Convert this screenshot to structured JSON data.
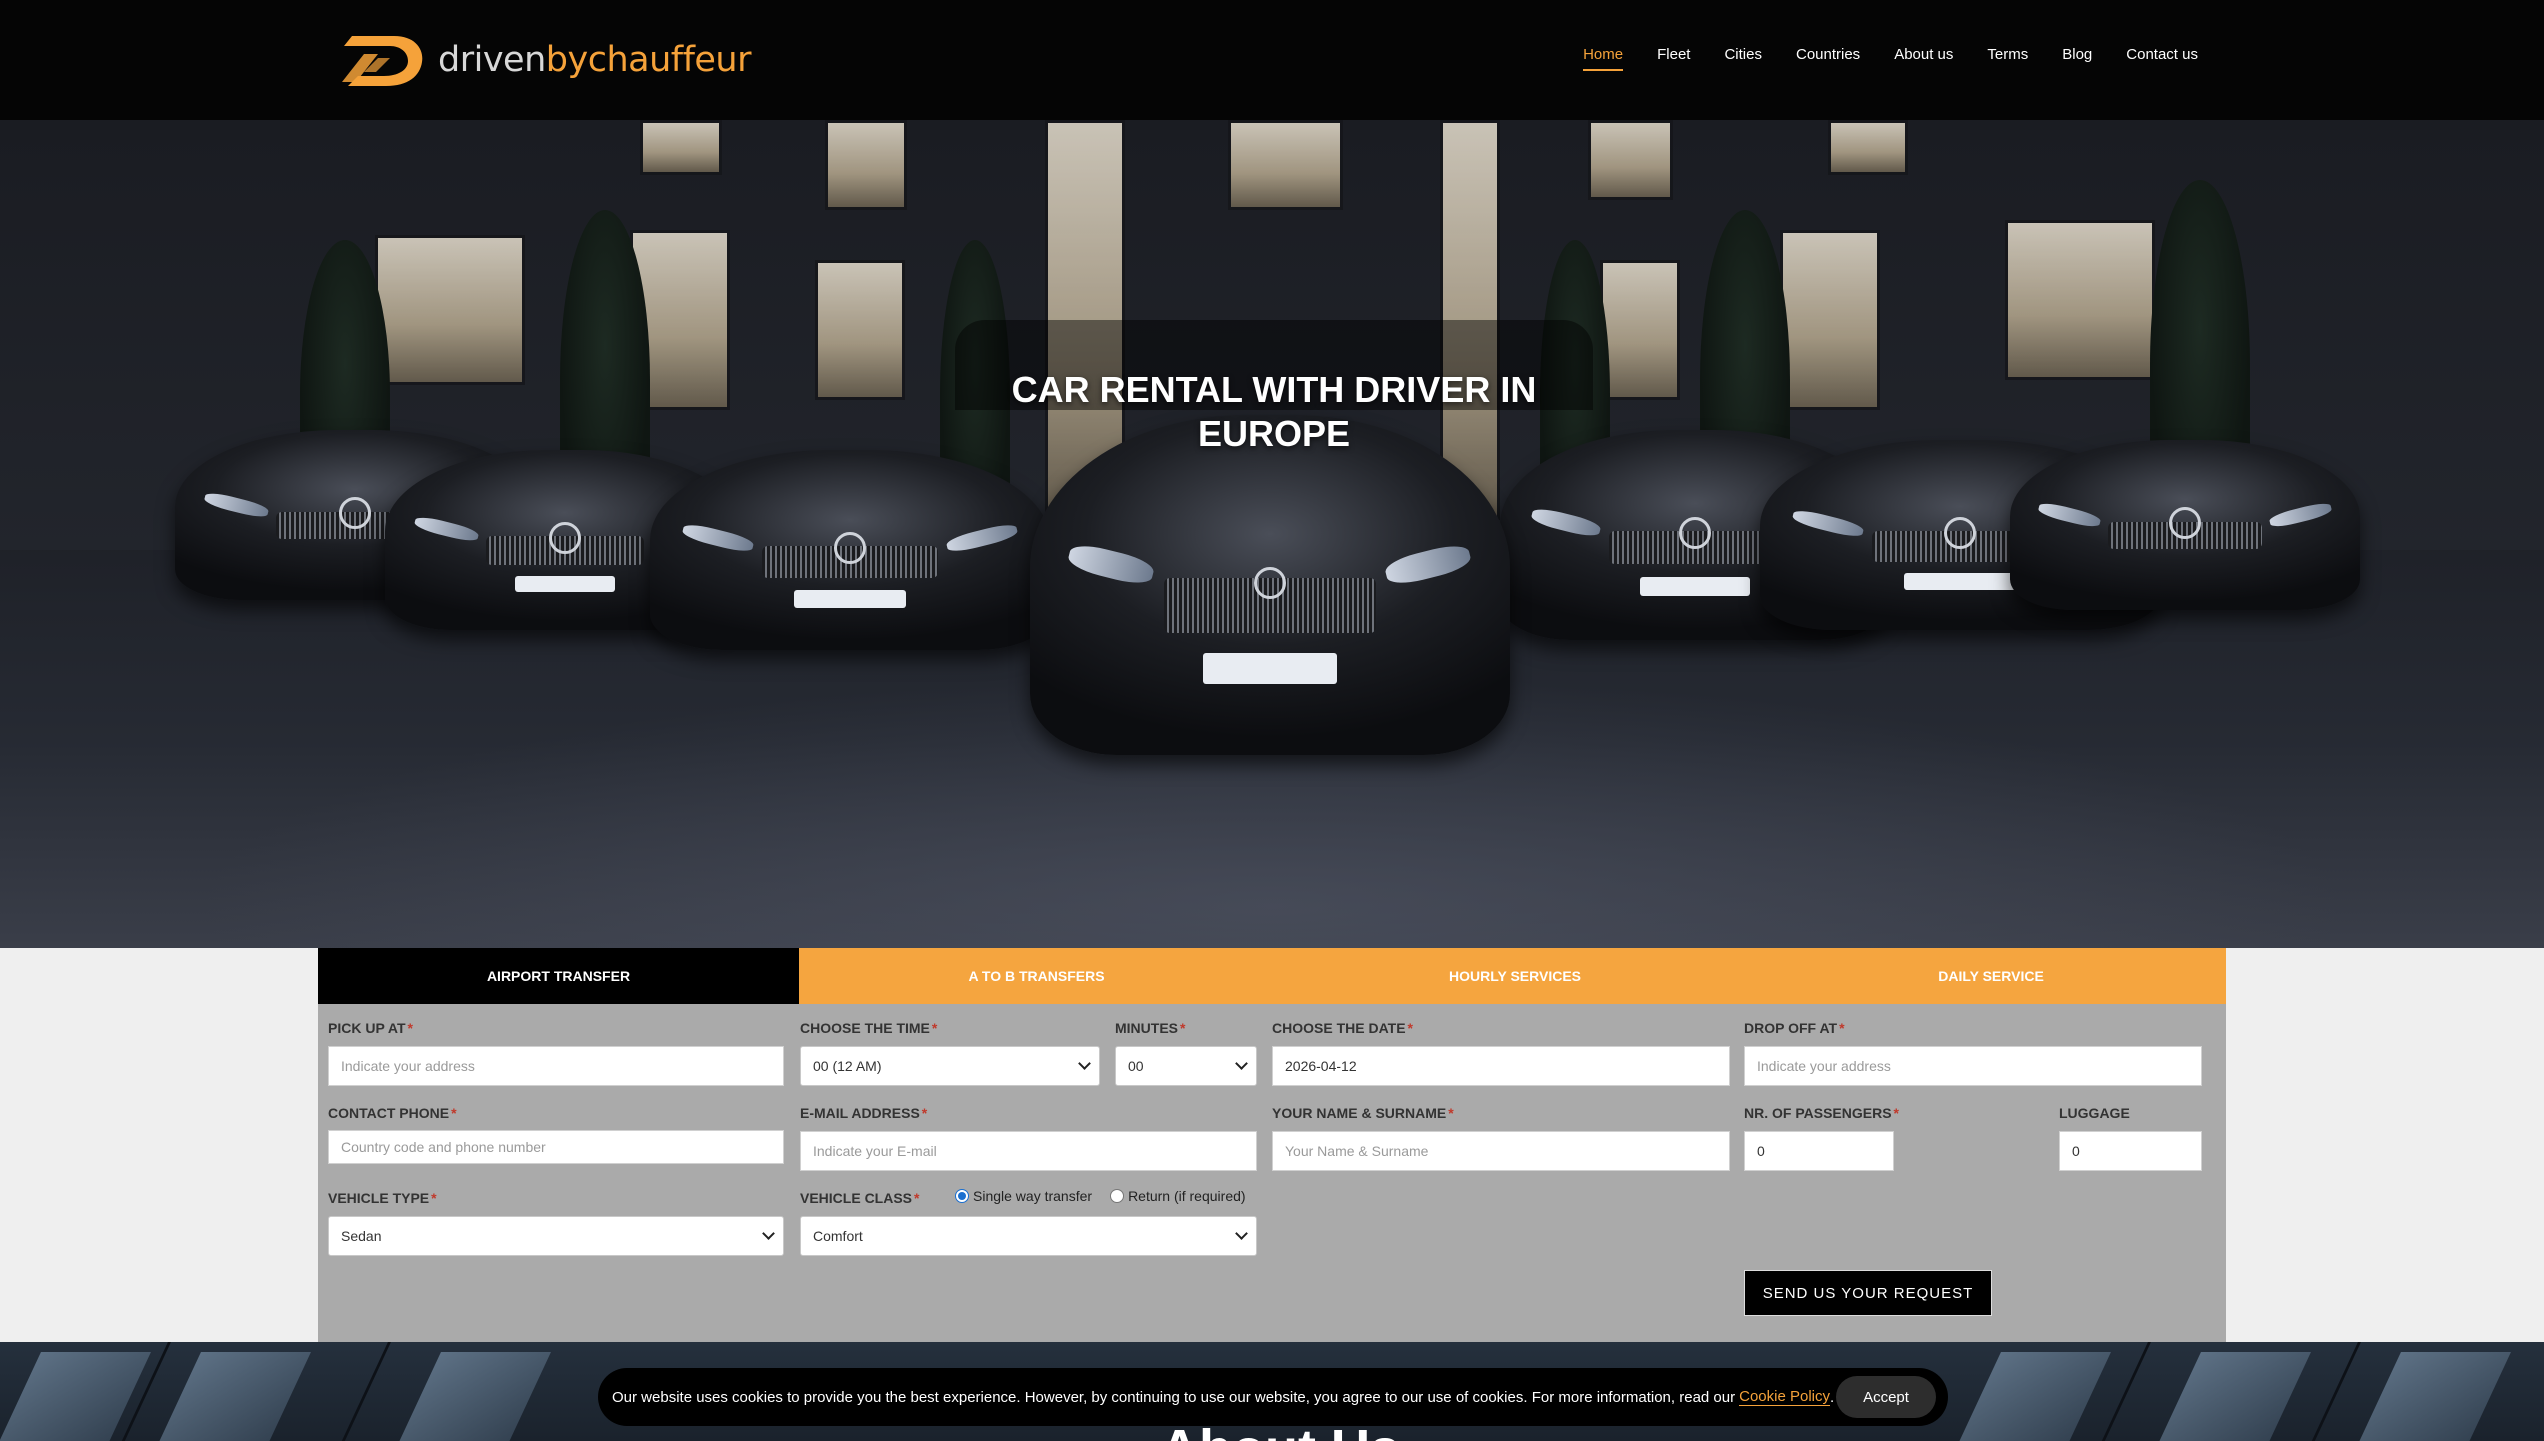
{
  "brand": {
    "logo_part1": "driven",
    "logo_part2": "bychauffeur",
    "accent_color": "#f5a23a"
  },
  "nav": {
    "items": [
      {
        "label": "Home",
        "active": true
      },
      {
        "label": "Fleet"
      },
      {
        "label": "Cities"
      },
      {
        "label": "Countries"
      },
      {
        "label": "About us"
      },
      {
        "label": "Terms"
      },
      {
        "label": "Blog"
      },
      {
        "label": "Contact us"
      }
    ]
  },
  "hero": {
    "title": "CAR RENTAL WITH DRIVER IN EUROPE"
  },
  "booking": {
    "tabs": [
      {
        "label": "AIRPORT TRANSFER",
        "active": true
      },
      {
        "label": "A TO B TRANSFERS"
      },
      {
        "label": "HOURLY SERVICES"
      },
      {
        "label": "DAILY SERVICE"
      }
    ],
    "pickup": {
      "label": "PICK UP AT",
      "placeholder": "Indicate your address"
    },
    "time": {
      "label": "CHOOSE THE TIME",
      "value": "00 (12 AM)"
    },
    "minutes": {
      "label": "MINUTES",
      "value": "00"
    },
    "date": {
      "label": "CHOOSE THE DATE",
      "value": "2026-04-12"
    },
    "dropoff": {
      "label": "DROP OFF AT",
      "placeholder": "Indicate your address"
    },
    "phone": {
      "label": "CONTACT PHONE",
      "placeholder": "Country code and phone number"
    },
    "email": {
      "label": "E-MAIL ADDRESS",
      "placeholder": "Indicate your E-mail"
    },
    "name": {
      "label": "YOUR NAME & SURNAME",
      "placeholder": "Your Name & Surname"
    },
    "passengers": {
      "label": "NR. OF PASSENGERS",
      "value": "0"
    },
    "luggage": {
      "label": "LUGGAGE",
      "value": "0"
    },
    "vehicle_type": {
      "label": "VEHICLE TYPE",
      "value": "Sedan"
    },
    "vehicle_class": {
      "label": "VEHICLE CLASS",
      "value": "Comfort"
    },
    "radio_single": "Single way transfer",
    "radio_return": "Return (if required)",
    "required_mark": "*",
    "submit_label": "SEND US YOUR REQUEST"
  },
  "about": {
    "title": "About Us"
  },
  "cookie": {
    "text": "Our website uses cookies to provide you the best experience. However, by continuing to use our website, you agree to our use of cookies. For more information, read our",
    "link_label": "Cookie Policy",
    "suffix": ".",
    "accept_label": "Accept"
  }
}
